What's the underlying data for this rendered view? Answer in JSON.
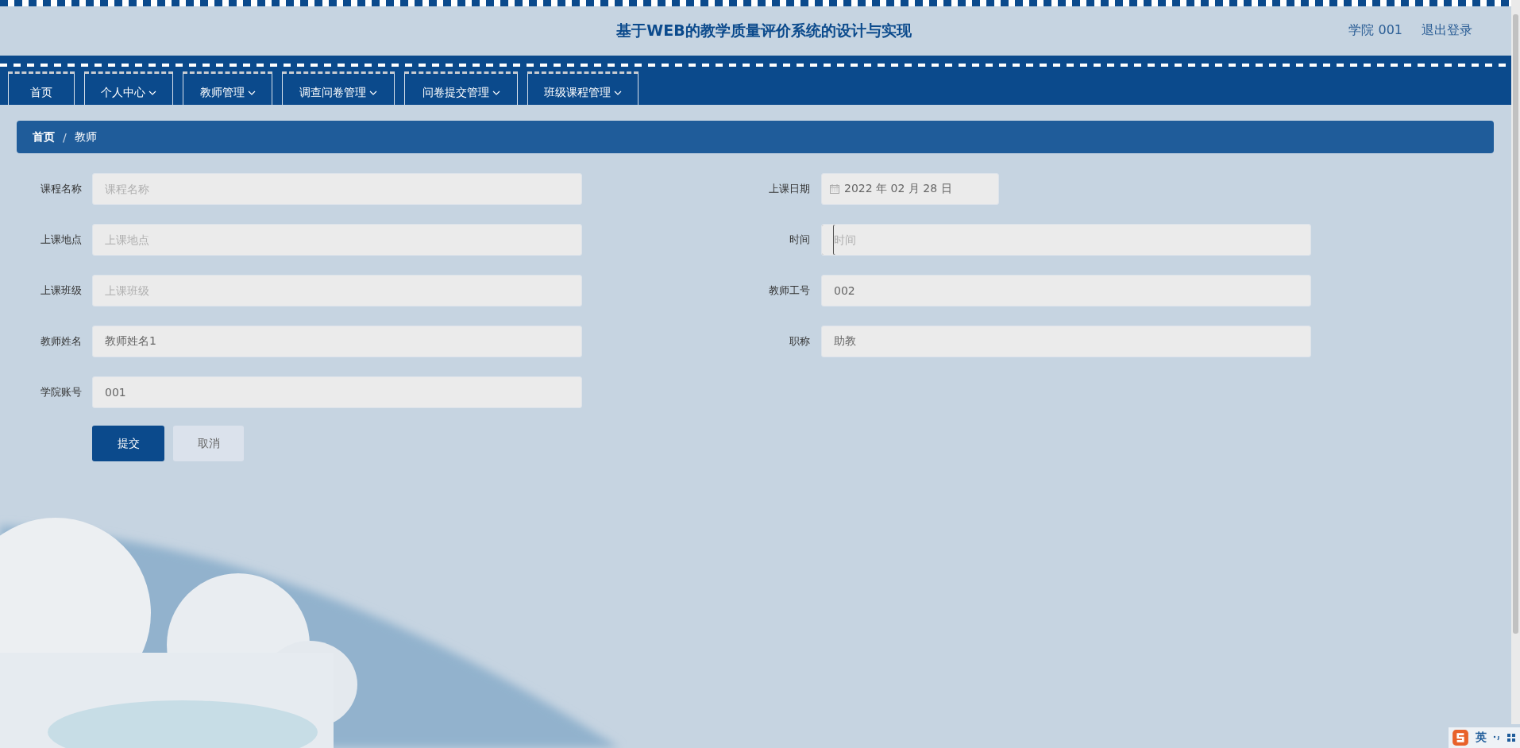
{
  "header": {
    "title": "基于WEB的教学质量评价系统的设计与实现",
    "user": "学院 001",
    "logout": "退出登录"
  },
  "nav": [
    {
      "label": "首页",
      "dropdown": false
    },
    {
      "label": "个人中心",
      "dropdown": true
    },
    {
      "label": "教师管理",
      "dropdown": true
    },
    {
      "label": "调查问卷管理",
      "dropdown": true
    },
    {
      "label": "问卷提交管理",
      "dropdown": true
    },
    {
      "label": "班级课程管理",
      "dropdown": true
    }
  ],
  "breadcrumb": [
    {
      "label": "首页",
      "current": false
    },
    {
      "label": "/",
      "kind": "separator"
    },
    {
      "label": "教师",
      "current": true
    }
  ],
  "form": {
    "fields": [
      {
        "label": "课程名称",
        "kind": "text",
        "placeholder": "课程名称"
      },
      {
        "label": "上课日期",
        "kind": "date",
        "value": "2022 年 02 月 28 日"
      },
      {
        "label": "上课地点",
        "kind": "text",
        "placeholder": "上课地点"
      },
      {
        "label": "时间",
        "kind": "text",
        "placeholder": "时间",
        "focused": true
      },
      {
        "label": "上课班级",
        "kind": "text",
        "placeholder": "上课班级"
      },
      {
        "label": "教师工号",
        "kind": "text",
        "value": "002"
      },
      {
        "label": "教师姓名",
        "kind": "text",
        "value": "教师姓名1"
      },
      {
        "label": "职称",
        "kind": "text",
        "value": "助教"
      },
      {
        "label": "学院账号",
        "kind": "text",
        "value": "001"
      }
    ],
    "buttons": [
      {
        "label": "提交",
        "kind": "primary"
      },
      {
        "label": "取消",
        "kind": "secondary"
      }
    ]
  },
  "ime_bar": {
    "mode": "英"
  }
}
